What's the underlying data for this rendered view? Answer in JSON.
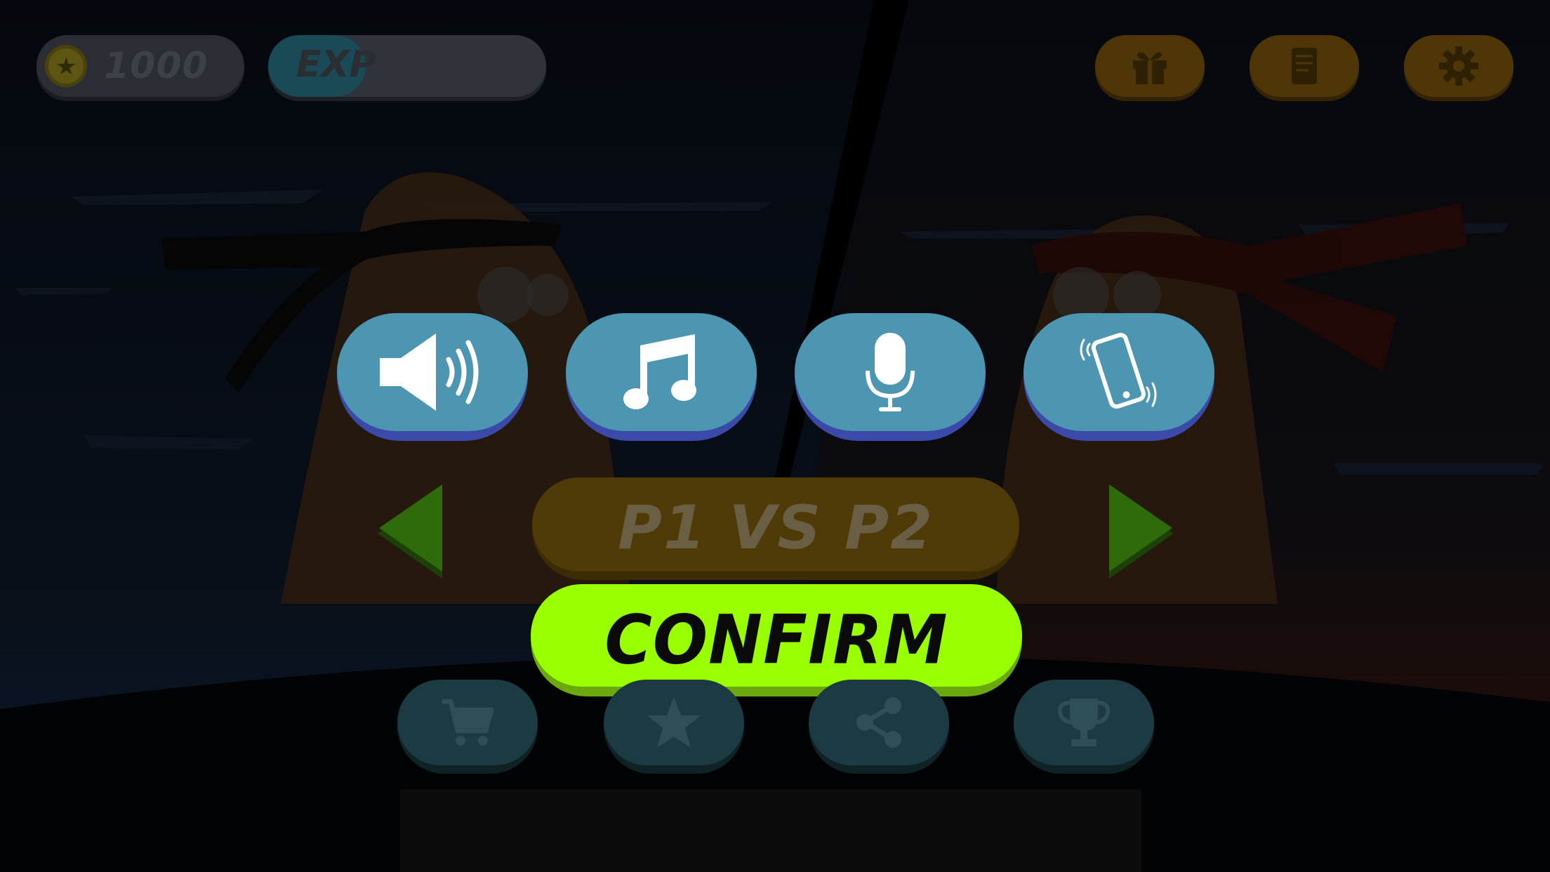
{
  "hud": {
    "coins": "1000",
    "exp_label": "EXP",
    "exp_progress": 0.35
  },
  "top_buttons": [
    {
      "name": "gift",
      "icon": "gift-icon"
    },
    {
      "name": "quests",
      "icon": "scroll-icon"
    },
    {
      "name": "settings",
      "icon": "gear-icon"
    }
  ],
  "settings_toggles": [
    {
      "name": "sound",
      "icon": "speaker-icon"
    },
    {
      "name": "music",
      "icon": "music-note-icon"
    },
    {
      "name": "voice",
      "icon": "microphone-icon"
    },
    {
      "name": "vibration",
      "icon": "vibrate-phone-icon"
    }
  ],
  "mode": {
    "label": "P1 VS P2"
  },
  "confirm": {
    "label": "CONFIRM"
  },
  "bottom_nav": [
    {
      "name": "shop",
      "icon": "cart-icon"
    },
    {
      "name": "rate",
      "icon": "star-icon"
    },
    {
      "name": "share",
      "icon": "share-icon"
    },
    {
      "name": "leaderboard",
      "icon": "trophy-icon"
    }
  ],
  "colors": {
    "toggle_button": "#4c96b2",
    "confirm_button": "#99ff00",
    "mode_button": "#4f3b07",
    "arrows": "#2f6b0b"
  }
}
